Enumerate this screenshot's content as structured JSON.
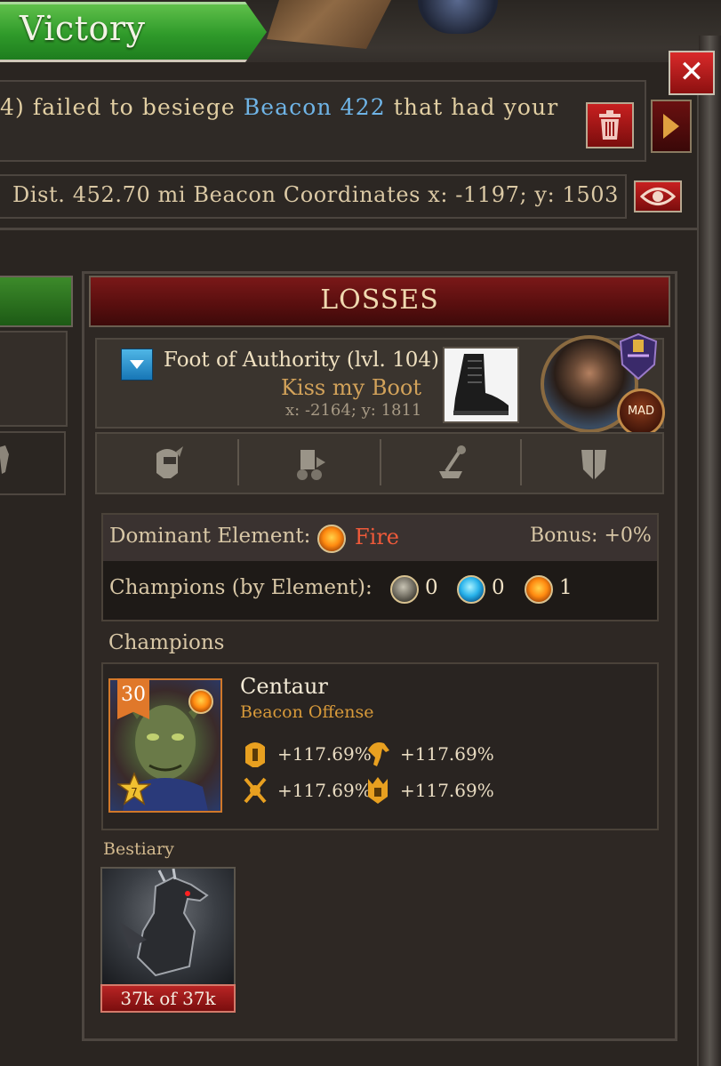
{
  "header": {
    "title": "Victory"
  },
  "message": {
    "prefix": "4) failed to besiege ",
    "target": "Beacon 422",
    "suffix": " that had your"
  },
  "coords_line": "Dist. 452.70 mi Beacon Coordinates x: -1197; y: 1503",
  "losses": {
    "title": "LOSSES",
    "player": {
      "name": "Foot of Authority (lvl. 104)",
      "alliance": "Kiss my Boot",
      "coords": "x: -2164; y: 1811",
      "badge": "MAD"
    },
    "element": {
      "dominant_label": "Dominant Element:",
      "dominant_value": "Fire",
      "bonus": "Bonus: +0%",
      "champions_label": "Champions (by Element):",
      "counts": {
        "earth": "0",
        "water": "0",
        "fire": "1"
      }
    },
    "champions_heading": "Champions",
    "champion": {
      "level": "30",
      "name": "Centaur",
      "role": "Beacon Offense",
      "stats": [
        "+117.69%",
        "+117.69%",
        "+117.69%",
        "+117.69%"
      ]
    },
    "bestiary": {
      "label": "Bestiary",
      "count": "37k of 37k"
    }
  },
  "colors": {
    "victory_green": "#2f9a2a",
    "losses_red": "#5a0f0f",
    "link_blue": "#6fb4e6",
    "fire_text": "#ef5a3a",
    "role_orange": "#d89a3a"
  }
}
